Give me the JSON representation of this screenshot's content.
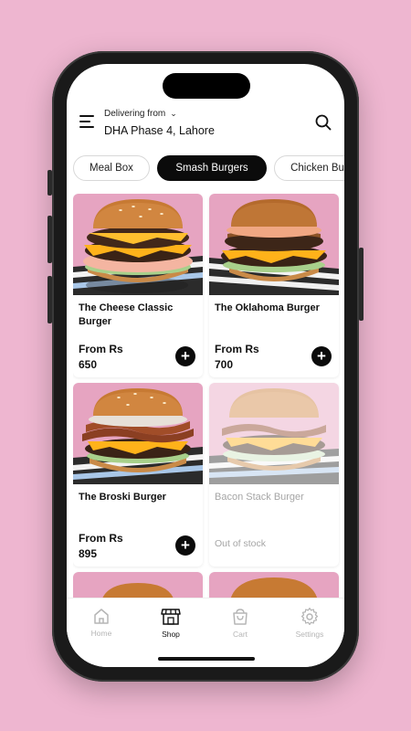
{
  "header": {
    "delivering_label": "Delivering from",
    "location": "DHA Phase 4, Lahore"
  },
  "tabs": [
    {
      "label": "Meal Box",
      "active": false
    },
    {
      "label": "Smash Burgers",
      "active": true
    },
    {
      "label": "Chicken Burg",
      "active": false
    }
  ],
  "products": [
    {
      "name": "The Cheese Classic Burger",
      "price_label": "From Rs",
      "price": "650",
      "in_stock": true
    },
    {
      "name": "The Oklahoma Burger",
      "price_label": "From Rs",
      "price": "700",
      "in_stock": true
    },
    {
      "name": "The Broski Burger",
      "price_label": "From Rs",
      "price": "895",
      "in_stock": true
    },
    {
      "name": "Bacon Stack Burger",
      "status": "Out of stock",
      "in_stock": false
    }
  ],
  "nav": [
    {
      "label": "Home",
      "icon": "home-icon",
      "active": false
    },
    {
      "label": "Shop",
      "icon": "shop-icon",
      "active": true
    },
    {
      "label": "Cart",
      "icon": "cart-icon",
      "active": false
    },
    {
      "label": "Settings",
      "icon": "gear-icon",
      "active": false
    }
  ],
  "colors": {
    "background": "#eeb6d0",
    "accent": "#0b0b0b",
    "muted": "#b5b5b5"
  }
}
